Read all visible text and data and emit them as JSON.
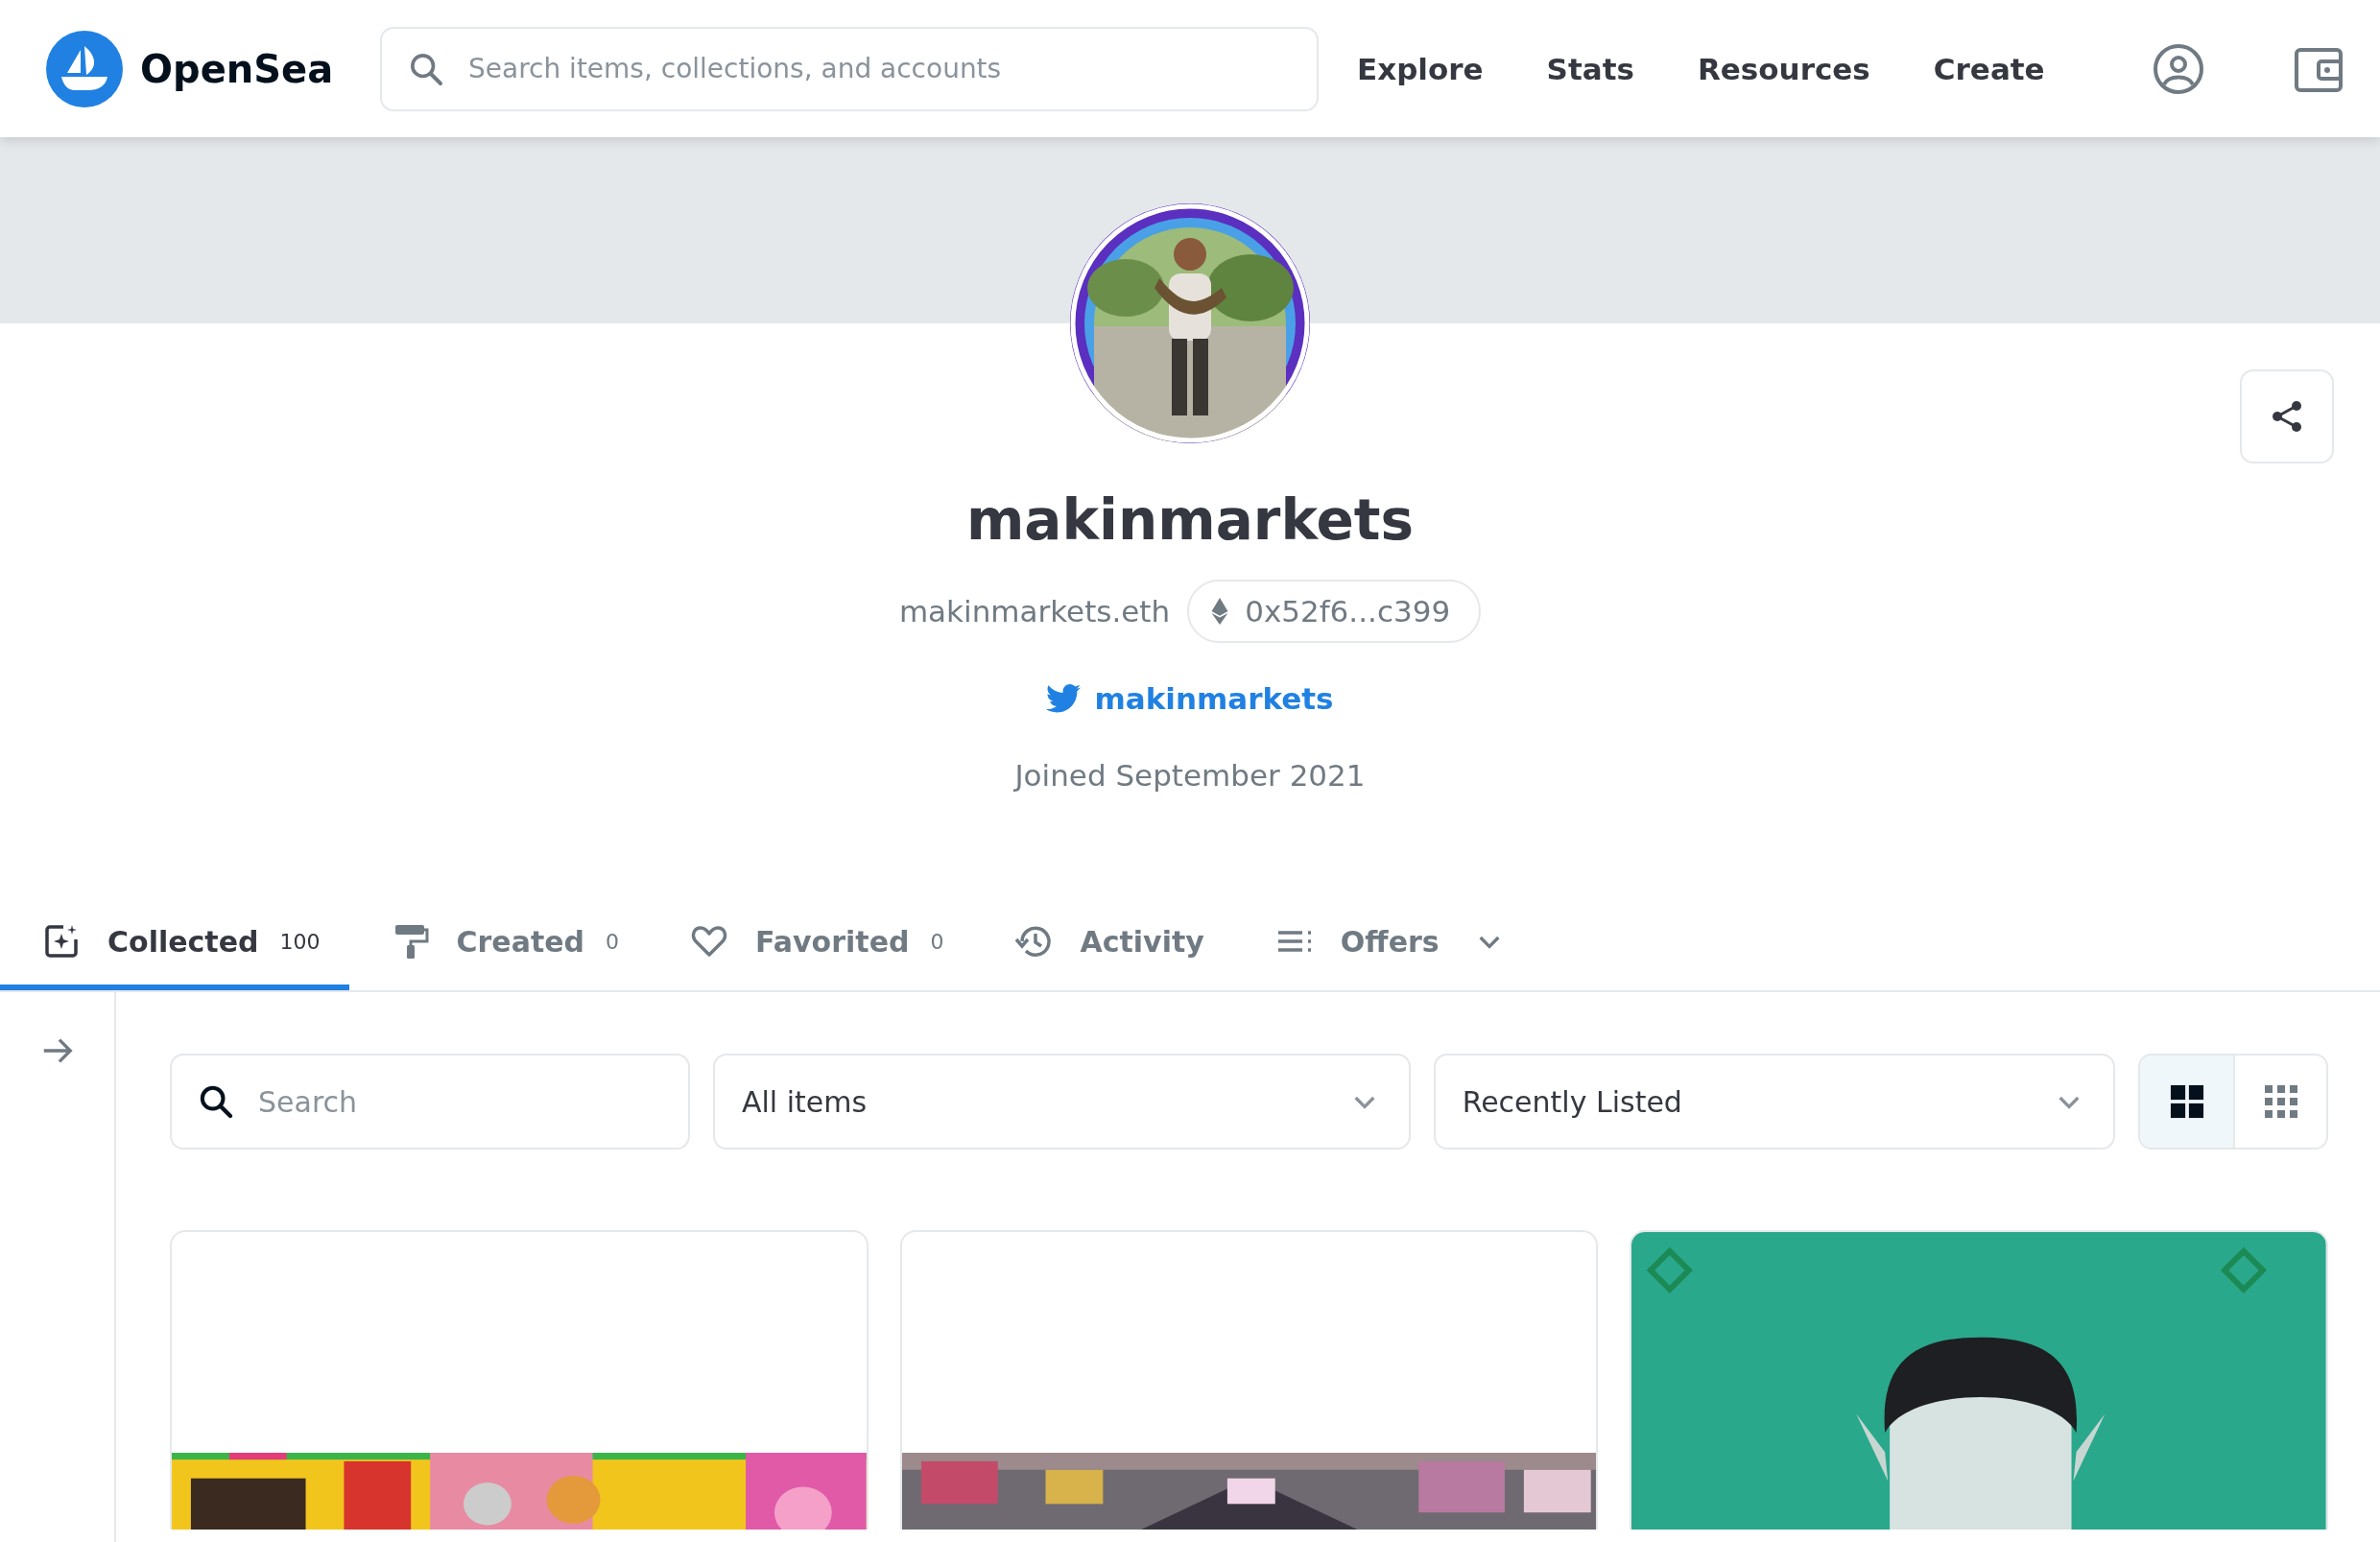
{
  "header": {
    "logo_text": "OpenSea",
    "search": {
      "placeholder": "Search items, collections, and accounts"
    },
    "nav": [
      "Explore",
      "Stats",
      "Resources",
      "Create"
    ]
  },
  "profile": {
    "name": "makinmarkets",
    "ens": "makinmarkets.eth",
    "address": "0x52f6...c399",
    "twitter": "makinmarkets",
    "joined": "Joined September 2021"
  },
  "tabs": [
    {
      "label": "Collected",
      "count": "100",
      "selected": true
    },
    {
      "label": "Created",
      "count": "0",
      "selected": false
    },
    {
      "label": "Favorited",
      "count": "0",
      "selected": false
    },
    {
      "label": "Activity",
      "selected": false
    },
    {
      "label": "Offers",
      "dropdown": true,
      "selected": false
    }
  ],
  "filters": {
    "search": {
      "placeholder": "Search"
    },
    "items_select": "All items",
    "sort_select": "Recently Listed",
    "views": [
      {
        "kind": "large",
        "selected": true
      },
      {
        "kind": "small",
        "selected": false
      }
    ]
  }
}
